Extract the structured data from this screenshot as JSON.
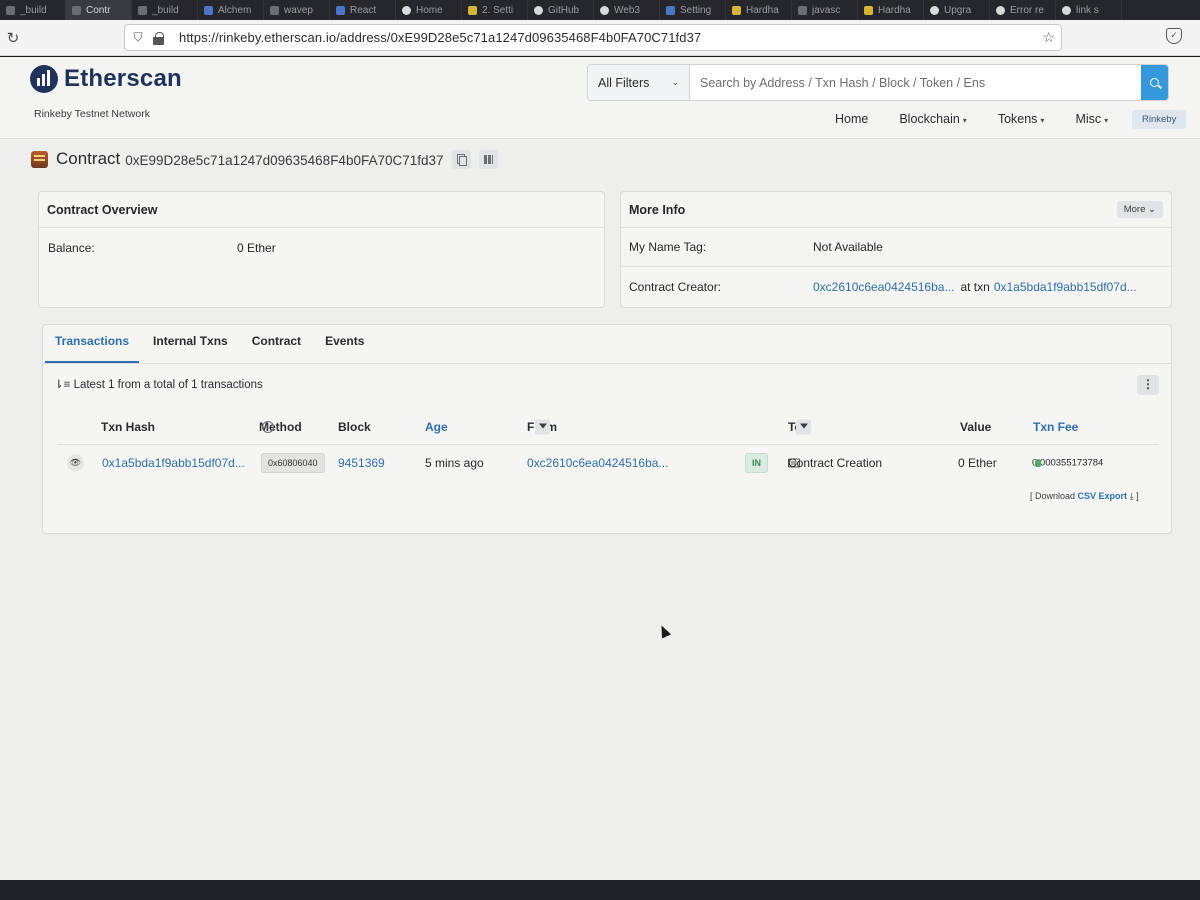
{
  "browser": {
    "tabs": [
      {
        "label": "_build",
        "fav": ""
      },
      {
        "label": "Contr",
        "fav": "",
        "active": true
      },
      {
        "label": "_build",
        "fav": ""
      },
      {
        "label": "Alchem",
        "fav": "b"
      },
      {
        "label": "wavep",
        "fav": ""
      },
      {
        "label": "React",
        "fav": "b"
      },
      {
        "label": "Home",
        "fav": "g"
      },
      {
        "label": "2. Setti",
        "fav": "y"
      },
      {
        "label": "GitHub",
        "fav": "g"
      },
      {
        "label": "Web3",
        "fav": "g"
      },
      {
        "label": "Setting",
        "fav": "b"
      },
      {
        "label": "Hardha",
        "fav": "y"
      },
      {
        "label": "javasc",
        "fav": ""
      },
      {
        "label": "Hardha",
        "fav": "y"
      },
      {
        "label": "Upgra",
        "fav": "g"
      },
      {
        "label": "Error re",
        "fav": "g"
      },
      {
        "label": "link s",
        "fav": "g"
      }
    ],
    "url": "https://rinkeby.etherscan.io/address/0xE99D28e5c71a1247d09635468F4b0FA70C71fd37"
  },
  "site": {
    "brand": "Etherscan",
    "network": "Rinkeby Testnet Network",
    "search": {
      "filter": "All Filters",
      "placeholder": "Search by Address / Txn Hash / Block / Token / Ens"
    },
    "menu": {
      "home": "Home",
      "blockchain": "Blockchain",
      "tokens": "Tokens",
      "misc": "Misc"
    },
    "network_badge": "Rinkeby"
  },
  "contract": {
    "label": "Contract",
    "address": "0xE99D28e5c71a1247d09635468F4b0FA70C71fd37"
  },
  "overview": {
    "title": "Contract Overview",
    "balance_label": "Balance:",
    "balance_value": "0 Ether"
  },
  "more_info": {
    "title": "More Info",
    "more_button": "More",
    "name_tag_label": "My Name Tag:",
    "name_tag_value": "Not Available",
    "creator_label": "Contract Creator:",
    "creator_address": "0xc2610c6ea0424516ba...",
    "at_txn": "at txn",
    "creator_txn": "0x1a5bda1f9abb15df07d..."
  },
  "txn_tabs": [
    "Transactions",
    "Internal Txns",
    "Contract",
    "Events"
  ],
  "summary": "Latest 1 from a total of 1 transactions",
  "table": {
    "headers": {
      "hash": "Txn Hash",
      "method": "Method",
      "block": "Block",
      "age": "Age",
      "from": "From",
      "to": "To",
      "value": "Value",
      "fee": "Txn Fee"
    },
    "rows": [
      {
        "hash": "0x1a5bda1f9abb15df07d...",
        "method": "0x60806040",
        "block": "9451369",
        "age": "5 mins ago",
        "from": "0xc2610c6ea0424516ba...",
        "direction": "IN",
        "to": "Contract Creation",
        "value": "0 Ether",
        "fee": "0.000355173784"
      }
    ]
  },
  "csv": {
    "prefix": "[ Download",
    "link": "CSV Export",
    "suffix": "]"
  },
  "colors": {
    "link": "#2f6fb0",
    "search_button": "#3498db",
    "in_badge": "#dcebe1"
  }
}
